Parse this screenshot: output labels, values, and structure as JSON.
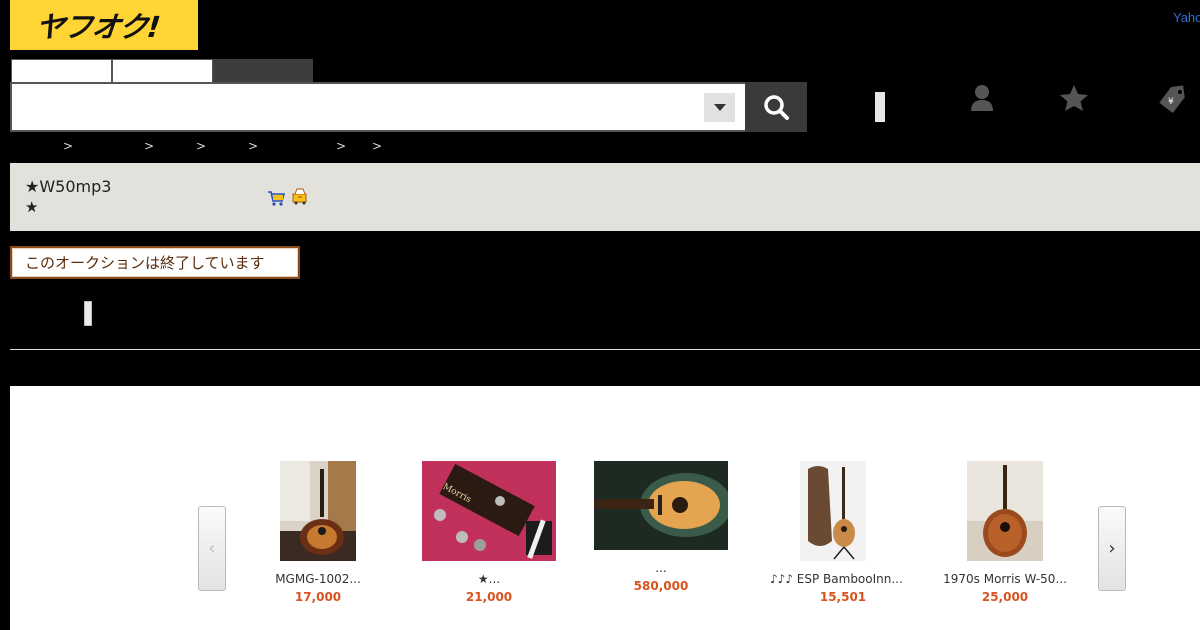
{
  "header": {
    "logo_text": "ヤフオク!",
    "yahoo_link": "Yahoo",
    "tabs": [
      "",
      "",
      ""
    ],
    "search": {
      "value": "",
      "placeholder": ""
    }
  },
  "breadcrumb": {
    "separators": [
      ">",
      ">",
      ">",
      ">",
      ">",
      ">"
    ]
  },
  "item": {
    "title_line1": "★W50mp3",
    "title_line2": "★",
    "status_badge": "このオークションは終了しています"
  },
  "recommendations": {
    "items": [
      {
        "name": "MGMG-1002...",
        "price": "17,000"
      },
      {
        "name": "★...",
        "price": "21,000"
      },
      {
        "name": "...",
        "price": "580,000"
      },
      {
        "name": "♪♪♪ ESP BambooInn...",
        "price": "15,501"
      },
      {
        "name": "1970s Morris W-50...",
        "price": "25,000"
      }
    ]
  },
  "colors": {
    "brand_yellow": "#ffd535",
    "price_orange": "#d9531e",
    "title_band": "#e2e1dc",
    "badge_border": "#8a4b1c"
  }
}
